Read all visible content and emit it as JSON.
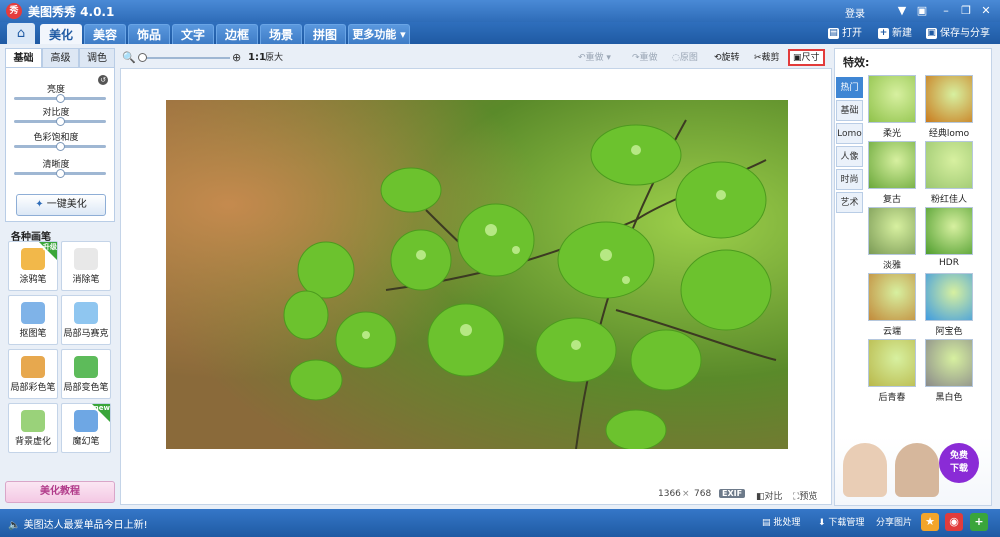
{
  "window": {
    "title": "美图秀秀 4.0.1",
    "logo_text": "秀",
    "login": "登录"
  },
  "nav": {
    "tabs": [
      "美化",
      "美容",
      "饰品",
      "文字",
      "边框",
      "场景",
      "拼图"
    ],
    "more": "更多功能",
    "active_index": 0,
    "open": "打开",
    "new": "新建",
    "save_share": "保存与分享"
  },
  "left": {
    "subtabs": [
      "基础",
      "高级",
      "调色"
    ],
    "sliders": [
      {
        "label": "亮度",
        "value": 0.5
      },
      {
        "label": "对比度",
        "value": 0.5
      },
      {
        "label": "色彩饱和度",
        "value": 0.5
      },
      {
        "label": "清晰度",
        "value": 0.5
      }
    ],
    "one_key": "一键美化",
    "brush_title": "各种画笔",
    "brushes": [
      {
        "label": "涂鸦笔",
        "badge": "升级"
      },
      {
        "label": "消除笔",
        "badge": ""
      },
      {
        "label": "抠图笔",
        "badge": ""
      },
      {
        "label": "局部马赛克",
        "badge": ""
      },
      {
        "label": "局部彩色笔",
        "badge": ""
      },
      {
        "label": "局部变色笔",
        "badge": ""
      },
      {
        "label": "背景虚化",
        "badge": ""
      },
      {
        "label": "魔幻笔",
        "badge": "new"
      }
    ],
    "tutorial": "美化教程"
  },
  "toolbar": {
    "ratio": "1:1",
    "original_size": "原大",
    "redo_left": "重做",
    "redo_right": "重做",
    "original": "原图",
    "rotate": "旋转",
    "crop": "裁剪",
    "size": "尺寸"
  },
  "canvas": {
    "width": "1366",
    "times": "×",
    "height": "768",
    "exif": "EXIF",
    "compare": "对比",
    "preview": "预览"
  },
  "effects": {
    "title": "特效:",
    "tabs": [
      "热门",
      "基础",
      "Lomo",
      "人像",
      "时尚",
      "艺术"
    ],
    "active_tab": 0,
    "items": [
      {
        "label": "柔光",
        "color": "#8fc24a"
      },
      {
        "label": "经典lomo",
        "color": "#c97a1d"
      },
      {
        "label": "复古",
        "color": "#6aa83a"
      },
      {
        "label": "粉红佳人",
        "color": "#9cc770"
      },
      {
        "label": "淡雅",
        "color": "#7a9a55"
      },
      {
        "label": "HDR",
        "color": "#4f9d2e"
      },
      {
        "label": "云端",
        "color": "#c28a3a"
      },
      {
        "label": "阿宝色",
        "color": "#3f9be0"
      },
      {
        "label": "后青春",
        "color": "#b9b84a"
      },
      {
        "label": "黑白色",
        "color": "#8a8a8a"
      }
    ],
    "ad_text": "免费\n下载"
  },
  "status": {
    "message": "美图达人最爱单品今日上新!",
    "batch": "批处理",
    "download_mgr": "下载管理",
    "share": "分享图片"
  }
}
